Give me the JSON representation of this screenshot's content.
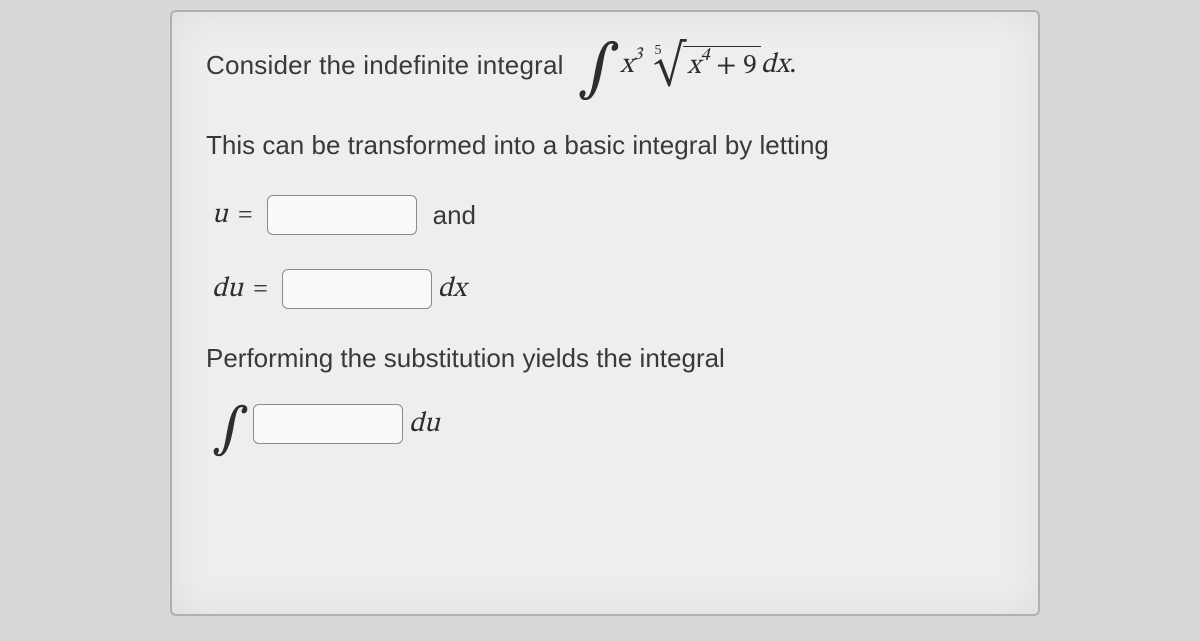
{
  "problem": {
    "intro_text": "Consider the indefinite integral",
    "integral": {
      "symbol": "∫",
      "integrand_x_coeff": "x",
      "integrand_x_power": "3",
      "root_index": "5",
      "root_symbol": "√",
      "radicand_x": "x",
      "radicand_x_power": "4",
      "plus": " + 9",
      "dx": " dx",
      "period": "."
    },
    "transform_text": "This can be transformed into a basic integral by letting",
    "u_label": "u",
    "equals": "=",
    "and_text": "and",
    "du_label": "du",
    "dx_unit": "dx",
    "perform_text": "Performing the substitution yields the integral",
    "result_integral_symbol": "∫",
    "du_unit": "du"
  }
}
